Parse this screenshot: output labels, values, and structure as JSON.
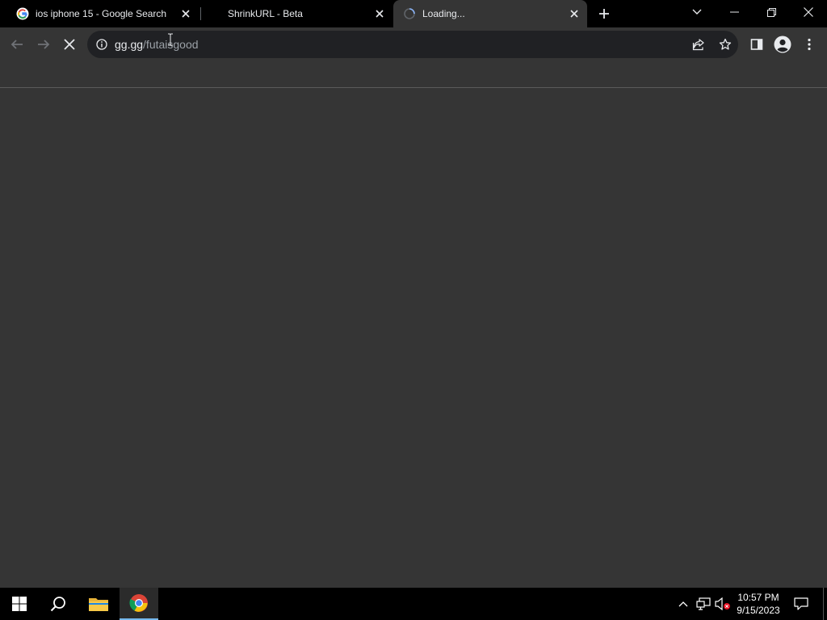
{
  "tabs": [
    {
      "title": "ios iphone 15 - Google Search",
      "favicon": "google-icon",
      "active": false
    },
    {
      "title": "ShrinkURL - Beta",
      "favicon": "none",
      "active": false
    },
    {
      "title": "Loading...",
      "favicon": "loading-spinner-icon",
      "active": true
    }
  ],
  "omnibox": {
    "host": "gg.gg",
    "path": "/futaisgood"
  },
  "taskbar": {
    "time": "10:57 PM",
    "date": "9/15/2023"
  },
  "colors": {
    "tabstrip_bg": "#000000",
    "toolbar_bg": "#353535",
    "omnibox_bg": "#202124",
    "page_bg": "#353535",
    "taskbar_bg": "#000000",
    "accent": "#76b9ed"
  }
}
